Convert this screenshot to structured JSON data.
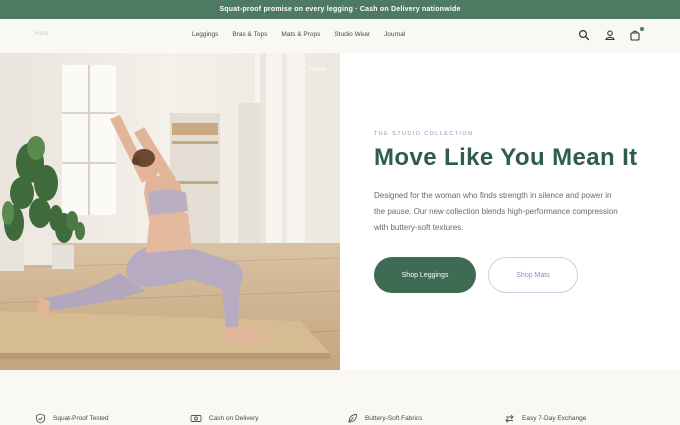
{
  "announcement": "Squat-proof promise on every legging · Cash on Delivery nationwide",
  "header": {
    "logo": "Haro",
    "nav": [
      "Leggings",
      "Bras & Tops",
      "Mats & Props",
      "Studio Wear",
      "Journal"
    ],
    "icons": [
      "search-icon",
      "account-icon",
      "bag-icon"
    ]
  },
  "hero": {
    "breadcrumb": "Home",
    "eyebrow": "THE STUDIO COLLECTION",
    "title": "Move Like You Mean It",
    "description": "Designed for the woman who finds strength in silence and power in the pause. Our new collection blends high-performance compression with buttery-soft textures.",
    "primary_cta": "Shop Leggings",
    "secondary_cta": "Shop Mats"
  },
  "features": [
    {
      "label": "Squat-Proof Tested",
      "icon": "shield-icon"
    },
    {
      "label": "Cash on Delivery",
      "icon": "cash-icon"
    },
    {
      "label": "Buttery-Soft Fabrics",
      "icon": "leaf-icon"
    },
    {
      "label": "Easy 7-Day Exchange",
      "icon": "exchange-icon"
    }
  ],
  "colors": {
    "brand_green": "#4e7a63",
    "title_green": "#2f5d47",
    "accent_lavender": "#8f8fc2",
    "cream": "#faf8f4"
  }
}
